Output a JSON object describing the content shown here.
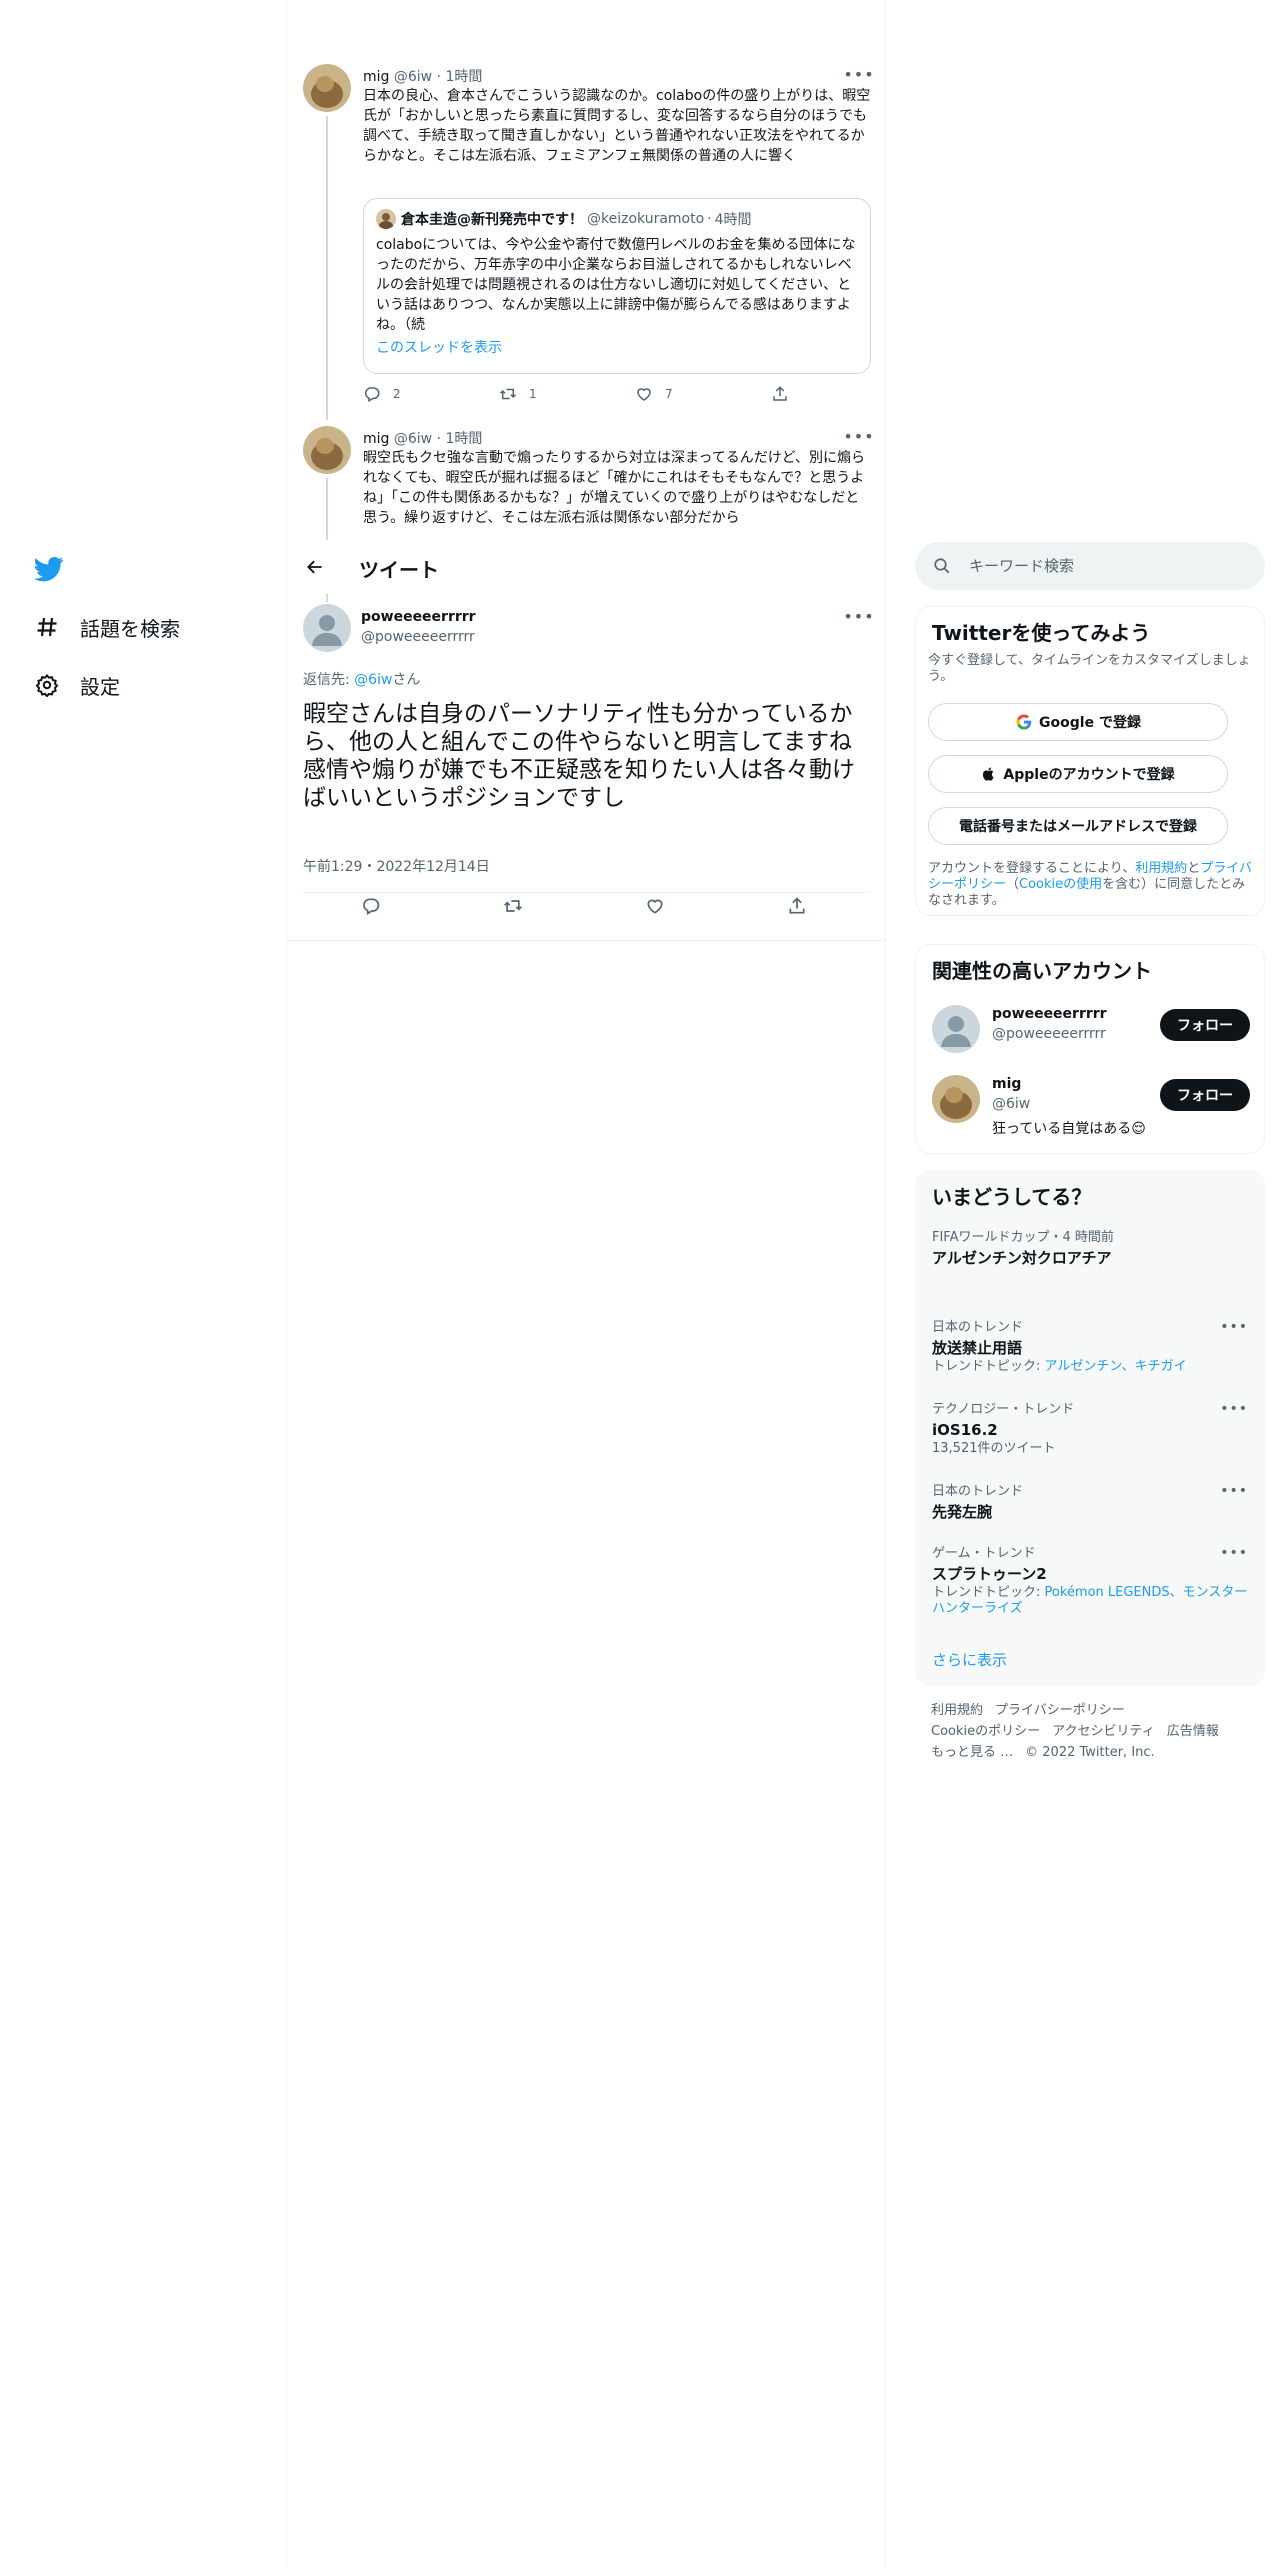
{
  "colors": {
    "accent": "#1d9bf0",
    "text": "#0f1419",
    "muted": "#536471",
    "border": "#eff3f4"
  },
  "nav": {
    "logo_icon": "twitter-bird-icon",
    "items": [
      {
        "label": "話題を検索",
        "icon": "hashtag-icon"
      },
      {
        "label": "設定",
        "icon": "gear-icon"
      }
    ]
  },
  "thread": [
    {
      "name": "mig",
      "handle": "@6iw",
      "dot": "·",
      "time": "1時間",
      "text": "日本の良心、倉本さんでこういう認識なのか。colaboの件の盛り上がりは、暇空氏が「おかしいと思ったら素直に質問するし、変な回答するなら自分のほうでも調べて、手続き取って聞き直しかない」という普通やれない正攻法をやれてるからかなと。そこは左派右派、フェミアンフェ無関係の普通の人に響く",
      "quote": {
        "name": "倉本圭造@新刊発売中です！",
        "handle": "@keizokuramoto",
        "dot": "·",
        "time": "4時間",
        "text": "colaboについては、今や公金や寄付で数億円レベルのお金を集める団体になったのだから、万年赤字の中小企業ならお目溢しされてるかもしれないレベルの会計処理では問題視されるのは仕方ないし適切に対処してください、という話はありつつ、なんか実態以上に誹謗中傷が膨らんでる感はありますよね。（続",
        "link": "このスレッドを表示"
      },
      "replies": "2",
      "retweets": "1",
      "likes": "7"
    },
    {
      "name": "mig",
      "handle": "@6iw",
      "dot": "·",
      "time": "1時間",
      "text": "暇空氏もクセ強な言動で煽ったりするから対立は深まってるんだけど、別に煽られなくても、暇空氏が掘れば掘るほど「確かにこれはそもそもなんで？と思うよね」「この件も関係あるかもな？」が増えていくので盛り上がりはやむなしだと思う。繰り返すけど、そこは左派右派は関係ない部分だから"
    }
  ],
  "header": {
    "title": "ツイート",
    "back_icon": "arrow-left-icon"
  },
  "main_tweet": {
    "name": "poweeeeerrrrr",
    "handle": "@poweeeeerrrrr",
    "reply_prefix": "返信先: ",
    "reply_to": "@6iw",
    "reply_suffix": "さん",
    "text_line1": "暇空さんは自身のパーソナリティ性も分かっているから、他の人と組んでこの件やらないと明言してますね",
    "text_line2": "感情や煽りが嫌でも不正疑惑を知りたい人は各々動けばいいというポジションですし",
    "timestamp": "午前1:29・2022年12月14日"
  },
  "search": {
    "placeholder": "キーワード検索"
  },
  "signup": {
    "title": "Twitterを使ってみよう",
    "subtitle": "今すぐ登録して、タイムラインをカスタマイズしましょう。",
    "google": "Google で登録",
    "apple": "Appleのアカウントで登録",
    "phone": "電話番号またはメールアドレスで登録",
    "legal_1": "アカウントを登録することにより、",
    "legal_terms": "利用規約",
    "legal_and": "と",
    "legal_privacy": "プライバシーポリシー",
    "legal_2": "（",
    "legal_cookie": "Cookieの使用",
    "legal_3": "を含む）に同意したとみなされます。"
  },
  "related": {
    "title": "関連性の高いアカウント",
    "accounts": [
      {
        "name": "poweeeeerrrrr",
        "handle": "@poweeeeerrrrr",
        "bio": "",
        "follow": "フォロー"
      },
      {
        "name": "mig",
        "handle": "@6iw",
        "bio": "狂っている自覚はある😌",
        "follow": "フォロー"
      }
    ]
  },
  "trends": {
    "title": "いまどうしてる？",
    "items": [
      {
        "meta": "FIFAワールドカップ・4 時間前",
        "name": "アルゼンチン対クロアチア",
        "extra": ""
      },
      {
        "meta": "日本のトレンド",
        "name": "放送禁止用語",
        "extra_prefix": "トレンドトピック: ",
        "extra_links": "アルゼンチン、キチガイ"
      },
      {
        "meta": "テクノロジー・トレンド",
        "name": "iOS16.2",
        "extra": "13,521件のツイート"
      },
      {
        "meta": "日本のトレンド",
        "name": "先発左腕",
        "extra": ""
      },
      {
        "meta": "ゲーム・トレンド",
        "name": "スプラトゥーン2",
        "extra_prefix": "トレンドトピック: ",
        "extra_links": "Pokémon LEGENDS、モンスターハンターライズ"
      }
    ],
    "more_icon": "more-horizontal-icon",
    "show_more": "さらに表示"
  },
  "footer": {
    "terms": "利用規約",
    "privacy": "プライバシーポリシー",
    "cookie": "Cookieのポリシー",
    "accessibility": "アクセシビリティ",
    "ads": "広告情報",
    "more": "もっと見る …",
    "copyright": "© 2022 Twitter, Inc."
  }
}
